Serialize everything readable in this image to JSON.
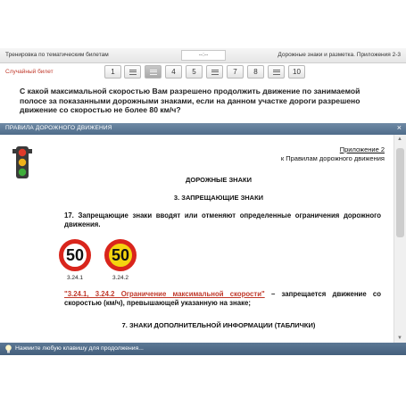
{
  "topbar": {
    "left_title": "Тренировка по тематическим билетам",
    "timer": "--:--",
    "right_title": "Дорожные знаки и разметка. Приложения 2-3"
  },
  "ticketbar": {
    "label": "Случайный билет",
    "buttons": [
      "1",
      "",
      "",
      "4",
      "5",
      "",
      "7",
      "8",
      "",
      "10"
    ],
    "active_index": 2
  },
  "question": {
    "text": "С какой максимальной скоростью Вам разрешено продолжить движение по занимаемой полосе за показанными дорожными знаками, если на данном участке дороги разрешено движение со скоростью не более 80 км/ч?"
  },
  "rules_panel": {
    "title": "ПРАВИЛА ДОРОЖНОГО ДВИЖЕНИЯ",
    "close_symbol": "×",
    "appendix_title": "Приложение 2",
    "appendix_subtitle": "к Правилам дорожного движения",
    "heading_1": "ДОРОЖНЫЕ ЗНАКИ",
    "heading_2": "3. ЗАПРЕЩАЮЩИЕ ЗНАКИ",
    "paragraph_17": "17. Запрещающие знаки вводят или отменяют определенные ограничения дорожного движения.",
    "signs": [
      {
        "value": "50",
        "caption": "3.24.1",
        "background": "#ffffff"
      },
      {
        "value": "50",
        "caption": "3.24.2",
        "background": "#f4d40f"
      }
    ],
    "sign_ref": "\"3.24.1, 3.24.2 Ограничение максимальной скорости\"",
    "sign_ref_rest": " – запрещается движение со скоростью (км/ч), превышающей указанную на знаке;",
    "heading_3": "7. ЗНАКИ ДОПОЛНИТЕЛЬНОЙ ИНФОРМАЦИИ (ТАБЛИЧКИ)"
  },
  "statusbar": {
    "text": "Нажмите любую клавишу для продолжения..."
  },
  "colors": {
    "accent_red": "#c0392b",
    "header_blue": "#5c7895",
    "sign_red": "#d9251c",
    "sign_yellow": "#f4d40f"
  },
  "icons": [
    "traffic-light-icon",
    "close-icon",
    "lightbulb-icon",
    "list-icon"
  ]
}
